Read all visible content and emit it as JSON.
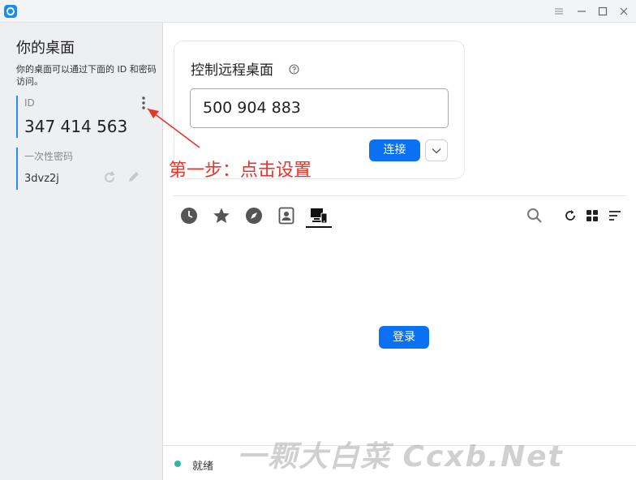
{
  "window": {
    "controls": [
      "menu",
      "minimize",
      "maximize",
      "close"
    ]
  },
  "left_panel": {
    "title": "你的桌面",
    "description": "你的桌面可以通过下面的 ID 和密码访问。",
    "id_label": "ID",
    "id_value": "347 414 563",
    "password_label": "一次性密码",
    "password_value": "3dvz2j"
  },
  "remote": {
    "title": "控制远程桌面",
    "input_value": "500 904 883",
    "connect_label": "连接"
  },
  "annotation": {
    "text": "第一步：点击设置",
    "color": "#e8342a"
  },
  "toolbar": {
    "tabs": [
      "recent-sessions",
      "favorites",
      "discovered",
      "address-book",
      "accessible-devices"
    ],
    "active_tab": "accessible-devices"
  },
  "main": {
    "login_label": "登录"
  },
  "status": {
    "text": "就绪",
    "color": "#31b5a3"
  },
  "watermark": {
    "text": "一颗大白菜 Ccxb.Net"
  },
  "colors": {
    "accent": "#0a72f2",
    "id_border": "#2c8cf4"
  }
}
